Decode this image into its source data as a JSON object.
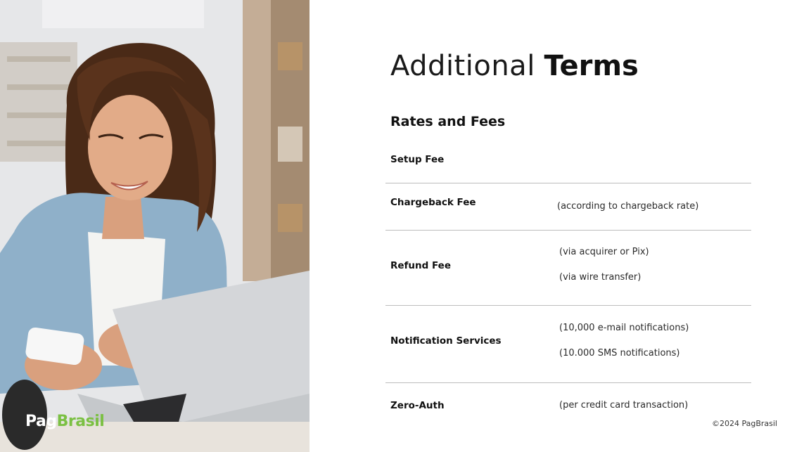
{
  "slide": {
    "title_light": "Additional",
    "title_bold": "Terms",
    "section_title": "Rates and Fees",
    "copyright": "©2024 PagBrasil"
  },
  "brand": {
    "logo_part1": "Pag",
    "logo_part2": "Brasil",
    "accent_color": "#7bc043"
  },
  "fees": [
    {
      "label": "Setup Fee",
      "notes": []
    },
    {
      "label": "Chargeback Fee",
      "notes": [
        "(according to chargeback rate)"
      ]
    },
    {
      "label": "Refund Fee",
      "notes": [
        "(via acquirer or Pix)",
        "(via wire transfer)"
      ]
    },
    {
      "label": "Notification Services",
      "notes": [
        "(10,000 e-mail notifications)",
        "(10.000 SMS notifications)"
      ]
    },
    {
      "label": "Zero-Auth",
      "notes": [
        "(per credit card transaction)"
      ]
    }
  ]
}
